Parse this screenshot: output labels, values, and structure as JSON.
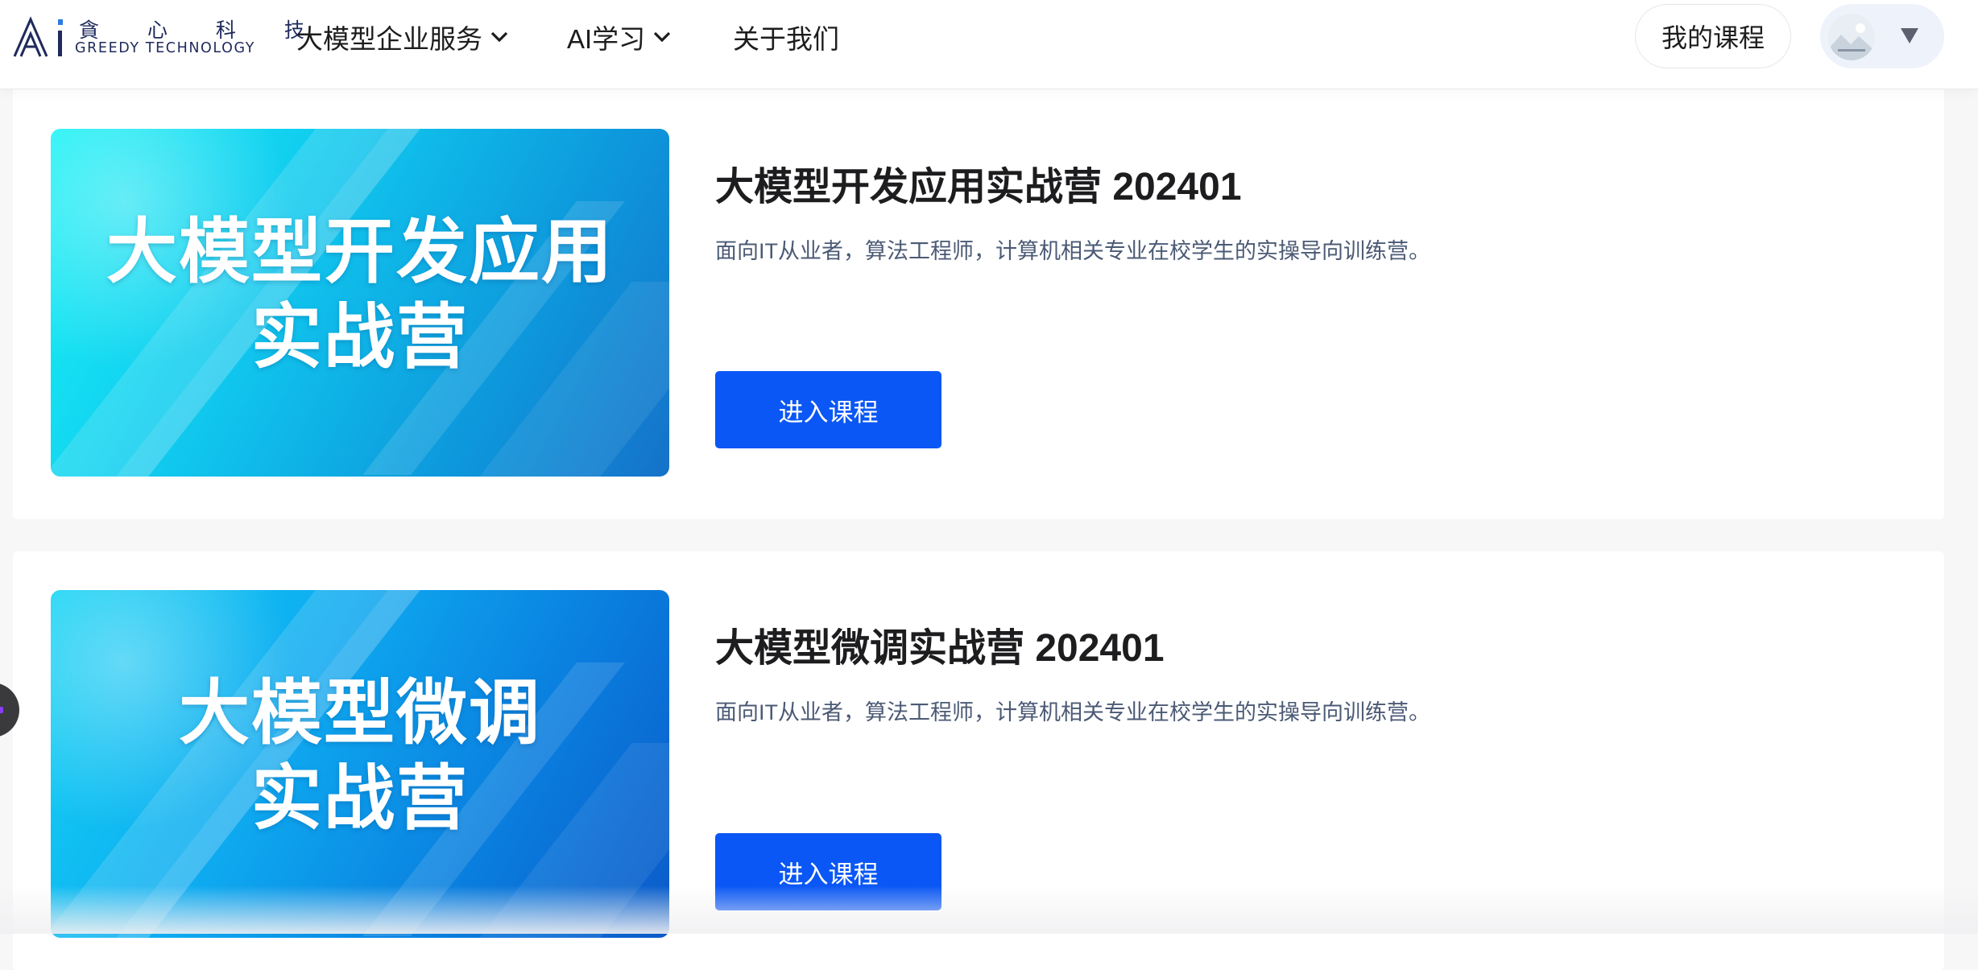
{
  "header": {
    "logo": {
      "cn_text": "貪 心 科 技",
      "en_text": "GREEDY TECHNOLOGY",
      "mark_icon": "ai-logo-icon"
    },
    "nav": [
      {
        "label": "大模型企业服务",
        "icon": "chevron-down-icon"
      },
      {
        "label": "AI学习",
        "icon": "chevron-down-icon"
      },
      {
        "label": "关于我们"
      }
    ],
    "my_courses_label": "我的课程",
    "user_menu": {
      "avatar_icon": "avatar-icon",
      "dropdown_icon": "caret-down-icon"
    }
  },
  "courses": [
    {
      "banner_line1": "大模型开发应用",
      "banner_line2": "实战营",
      "title": "大模型开发应用实战营 202401",
      "description": "面向IT从业者，算法工程师，计算机相关专业在校学生的实操导向训练营。",
      "button_label": "进入课程"
    },
    {
      "banner_line1": "大模型微调",
      "banner_line2": "实战营",
      "title": "大模型微调实战营 202401",
      "description": "面向IT从业者，算法工程师，计算机相关专业在校学生的实操导向训练营。",
      "button_label": "进入课程"
    }
  ],
  "colors": {
    "primary_button": "#0a57f5",
    "title_text": "#1d1d1f",
    "description_text": "#4b5a75",
    "logo": "#1f2a5c"
  }
}
